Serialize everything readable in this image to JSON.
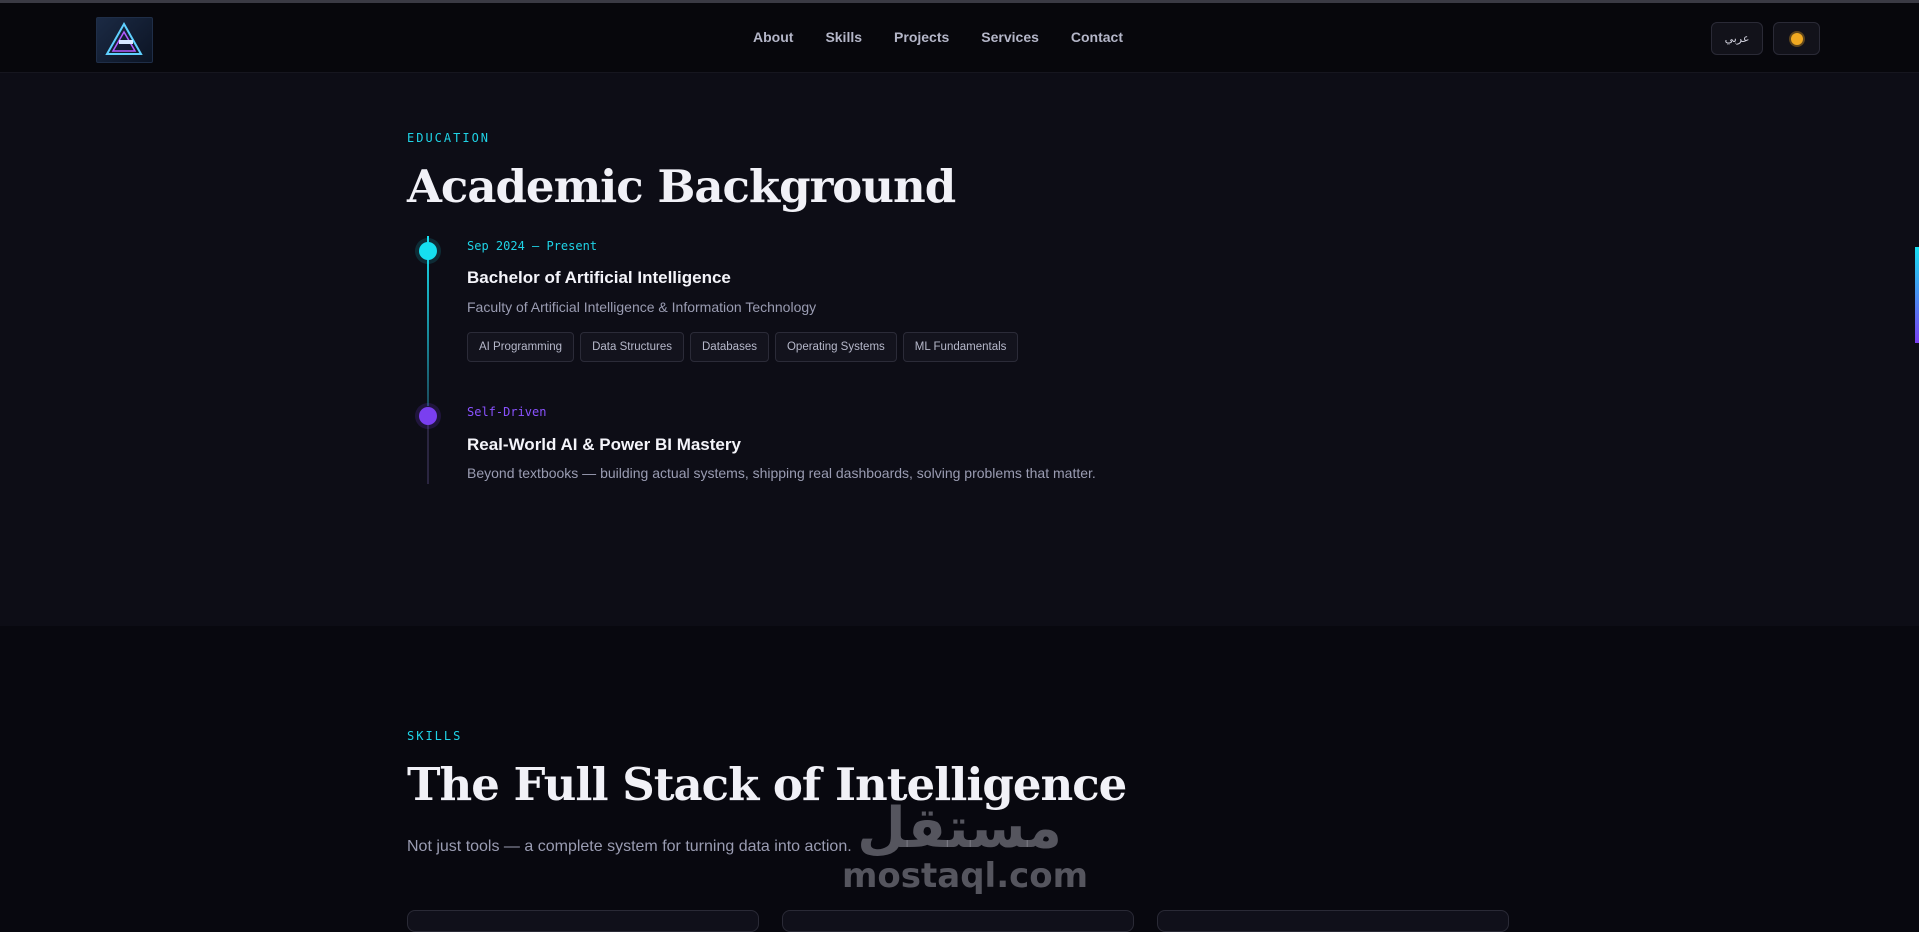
{
  "nav": {
    "links": [
      "About",
      "Skills",
      "Projects",
      "Services",
      "Contact"
    ],
    "lang_toggle": "عربي",
    "theme_icon": "sun-icon"
  },
  "education": {
    "eyebrow": "EDUCATION",
    "title": "Academic Background",
    "items": [
      {
        "date": "Sep 2024 — Present",
        "title": "Bachelor of Artificial Intelligence",
        "subtitle": "Faculty of Artificial Intelligence & Information Technology",
        "tags": [
          "AI Programming",
          "Data Structures",
          "Databases",
          "Operating Systems",
          "ML Fundamentals"
        ]
      },
      {
        "date": "Self-Driven",
        "title": "Real-World AI & Power BI Mastery",
        "subtitle": "Beyond textbooks — building actual systems, shipping real dashboards, solving problems that matter."
      }
    ]
  },
  "skills": {
    "eyebrow": "SKILLS",
    "title": "The Full Stack of Intelligence",
    "subtitle": "Not just tools — a complete system for turning data into action."
  },
  "watermark": {
    "arabic": "مستقل",
    "latin": "mostaql.com"
  },
  "colors": {
    "accent_cyan": "#16dff0",
    "accent_purple": "#7a3ff0",
    "background": "#08080f",
    "section_background": "#0d0d16"
  }
}
